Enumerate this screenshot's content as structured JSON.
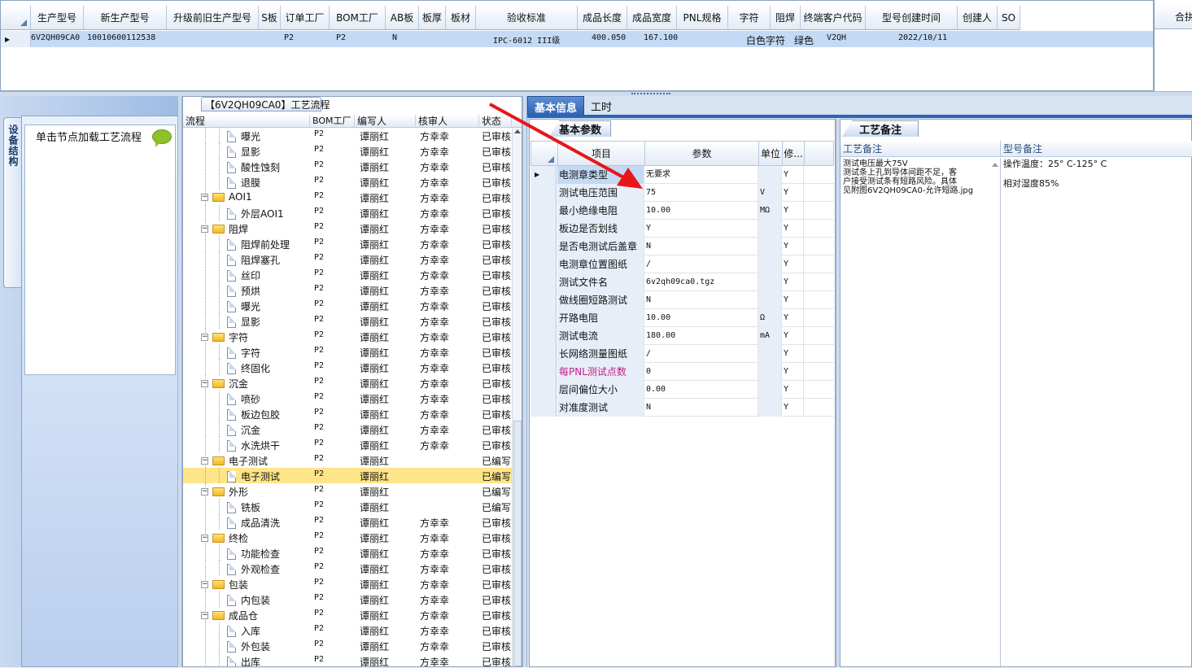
{
  "top_grid": {
    "columns": [
      "生产型号",
      "新生产型号",
      "升级前旧生产型号",
      "S板",
      "订单工厂",
      "BOM工厂",
      "AB板",
      "板厚",
      "板材",
      "验收标准",
      "成品长度",
      "成品宽度",
      "PNL规格",
      "字符",
      "阻焊",
      "终端客户代码",
      "型号创建时间",
      "创建人",
      "SO"
    ],
    "row": {
      "production_model": "6V2QH09CA0",
      "new_model": "10010600112538",
      "order_factory": "P2",
      "bom_factory": "P2",
      "ab_board": "N",
      "acceptance_standard": "IPC-6012 III级",
      "finished_length": "400.050",
      "finished_width": "167.100",
      "character": "白色字符",
      "solder_mask": "绿色",
      "customer_code": "V2QH",
      "created_time": "2022/10/11"
    },
    "right_header": "合拼"
  },
  "left_panel": {
    "vertical_tab": "设备结构",
    "load_hint": "单击节点加载工艺流程"
  },
  "flow": {
    "title": "【6V2QH09CA0】工艺流程",
    "columns": [
      "流程",
      "BOM工厂",
      "编写人",
      "核审人",
      "状态"
    ],
    "rows": [
      {
        "name": "曝光",
        "level": 2,
        "factory": "P2",
        "writer": "谭丽红",
        "reviewer": "方幸幸",
        "status": "已审核"
      },
      {
        "name": "显影",
        "level": 2,
        "factory": "P2",
        "writer": "谭丽红",
        "reviewer": "方幸幸",
        "status": "已审核"
      },
      {
        "name": "酸性蚀刻",
        "level": 2,
        "factory": "P2",
        "writer": "谭丽红",
        "reviewer": "方幸幸",
        "status": "已审核"
      },
      {
        "name": "退膜",
        "level": 2,
        "factory": "P2",
        "writer": "谭丽红",
        "reviewer": "方幸幸",
        "status": "已审核"
      },
      {
        "name": "AOI1",
        "level": 1,
        "factory": "P2",
        "writer": "谭丽红",
        "reviewer": "方幸幸",
        "status": "已审核"
      },
      {
        "name": "外层AOI1",
        "level": 2,
        "factory": "P2",
        "writer": "谭丽红",
        "reviewer": "方幸幸",
        "status": "已审核"
      },
      {
        "name": "阻焊",
        "level": 1,
        "factory": "P2",
        "writer": "谭丽红",
        "reviewer": "方幸幸",
        "status": "已审核"
      },
      {
        "name": "阻焊前处理",
        "level": 2,
        "factory": "P2",
        "writer": "谭丽红",
        "reviewer": "方幸幸",
        "status": "已审核"
      },
      {
        "name": "阻焊塞孔",
        "level": 2,
        "factory": "P2",
        "writer": "谭丽红",
        "reviewer": "方幸幸",
        "status": "已审核"
      },
      {
        "name": "丝印",
        "level": 2,
        "factory": "P2",
        "writer": "谭丽红",
        "reviewer": "方幸幸",
        "status": "已审核"
      },
      {
        "name": "预烘",
        "level": 2,
        "factory": "P2",
        "writer": "谭丽红",
        "reviewer": "方幸幸",
        "status": "已审核"
      },
      {
        "name": "曝光",
        "level": 2,
        "factory": "P2",
        "writer": "谭丽红",
        "reviewer": "方幸幸",
        "status": "已审核"
      },
      {
        "name": "显影",
        "level": 2,
        "factory": "P2",
        "writer": "谭丽红",
        "reviewer": "方幸幸",
        "status": "已审核"
      },
      {
        "name": "字符",
        "level": 1,
        "factory": "P2",
        "writer": "谭丽红",
        "reviewer": "方幸幸",
        "status": "已审核"
      },
      {
        "name": "字符",
        "level": 2,
        "factory": "P2",
        "writer": "谭丽红",
        "reviewer": "方幸幸",
        "status": "已审核"
      },
      {
        "name": "终固化",
        "level": 2,
        "factory": "P2",
        "writer": "谭丽红",
        "reviewer": "方幸幸",
        "status": "已审核"
      },
      {
        "name": "沉金",
        "level": 1,
        "factory": "P2",
        "writer": "谭丽红",
        "reviewer": "方幸幸",
        "status": "已审核"
      },
      {
        "name": "喷砂",
        "level": 2,
        "factory": "P2",
        "writer": "谭丽红",
        "reviewer": "方幸幸",
        "status": "已审核"
      },
      {
        "name": "板边包胶",
        "level": 2,
        "factory": "P2",
        "writer": "谭丽红",
        "reviewer": "方幸幸",
        "status": "已审核"
      },
      {
        "name": "沉金",
        "level": 2,
        "factory": "P2",
        "writer": "谭丽红",
        "reviewer": "方幸幸",
        "status": "已审核"
      },
      {
        "name": "水洗烘干",
        "level": 2,
        "factory": "P2",
        "writer": "谭丽红",
        "reviewer": "方幸幸",
        "status": "已审核"
      },
      {
        "name": "电子测试",
        "level": 1,
        "factory": "P2",
        "writer": "谭丽红",
        "reviewer": "",
        "status": "已编写"
      },
      {
        "name": "电子测试",
        "level": 2,
        "factory": "P2",
        "writer": "谭丽红",
        "reviewer": "",
        "status": "已编写",
        "selected": true
      },
      {
        "name": "外形",
        "level": 1,
        "factory": "P2",
        "writer": "谭丽红",
        "reviewer": "",
        "status": "已编写"
      },
      {
        "name": "铣板",
        "level": 2,
        "factory": "P2",
        "writer": "谭丽红",
        "reviewer": "",
        "status": "已编写"
      },
      {
        "name": "成品清洗",
        "level": 2,
        "factory": "P2",
        "writer": "谭丽红",
        "reviewer": "方幸幸",
        "status": "已审核"
      },
      {
        "name": "终检",
        "level": 1,
        "factory": "P2",
        "writer": "谭丽红",
        "reviewer": "方幸幸",
        "status": "已审核"
      },
      {
        "name": "功能检查",
        "level": 2,
        "factory": "P2",
        "writer": "谭丽红",
        "reviewer": "方幸幸",
        "status": "已审核"
      },
      {
        "name": "外观检查",
        "level": 2,
        "factory": "P2",
        "writer": "谭丽红",
        "reviewer": "方幸幸",
        "status": "已审核"
      },
      {
        "name": "包装",
        "level": 1,
        "factory": "P2",
        "writer": "谭丽红",
        "reviewer": "方幸幸",
        "status": "已审核"
      },
      {
        "name": "内包装",
        "level": 2,
        "factory": "P2",
        "writer": "谭丽红",
        "reviewer": "方幸幸",
        "status": "已审核"
      },
      {
        "name": "成品仓",
        "level": 1,
        "factory": "P2",
        "writer": "谭丽红",
        "reviewer": "方幸幸",
        "status": "已审核"
      },
      {
        "name": "入库",
        "level": 2,
        "factory": "P2",
        "writer": "谭丽红",
        "reviewer": "方幸幸",
        "status": "已审核"
      },
      {
        "name": "外包装",
        "level": 2,
        "factory": "P2",
        "writer": "谭丽红",
        "reviewer": "方幸幸",
        "status": "已审核"
      },
      {
        "name": "出库",
        "level": 2,
        "factory": "P2",
        "writer": "谭丽红",
        "reviewer": "方幸幸",
        "status": "已审核"
      }
    ]
  },
  "tabs": [
    {
      "label": "基本信息",
      "active": true
    },
    {
      "label": "工时",
      "active": false
    }
  ],
  "params": {
    "subtab": "基本参数",
    "columns": [
      "项目",
      "参数",
      "单位",
      "修..."
    ],
    "rows": [
      {
        "item": "电测章类型",
        "value": "无要求",
        "unit": "",
        "mod": "Y",
        "current": true
      },
      {
        "item": "测试电压范围",
        "value": "75",
        "unit": "V",
        "mod": "Y"
      },
      {
        "item": "最小绝缘电阻",
        "value": "10.00",
        "unit": "MΩ",
        "mod": "Y"
      },
      {
        "item": "板边是否划线",
        "value": "Y",
        "unit": "",
        "mod": "Y"
      },
      {
        "item": "是否电测试后盖章",
        "value": "N",
        "unit": "",
        "mod": "Y"
      },
      {
        "item": "电测章位置图纸",
        "value": "/",
        "unit": "",
        "mod": "Y"
      },
      {
        "item": "测试文件名",
        "value": "6v2qh09ca0.tgz",
        "unit": "",
        "mod": "Y"
      },
      {
        "item": "做线圈短路测试",
        "value": "N",
        "unit": "",
        "mod": "Y"
      },
      {
        "item": "开路电阻",
        "value": "10.00",
        "unit": "Ω",
        "mod": "Y"
      },
      {
        "item": "测试电流",
        "value": "180.00",
        "unit": "mA",
        "mod": "Y"
      },
      {
        "item": "长网络测量图纸",
        "value": "/",
        "unit": "",
        "mod": "Y"
      },
      {
        "item": "每PNL测试点数",
        "value": "0",
        "unit": "",
        "mod": "Y",
        "pink": true
      },
      {
        "item": "层间偏位大小",
        "value": "0.00",
        "unit": "",
        "mod": "Y"
      },
      {
        "item": "对准度测试",
        "value": "N",
        "unit": "",
        "mod": "Y"
      }
    ]
  },
  "notes": {
    "subtab": "工艺备注",
    "columns": [
      "工艺备注",
      "型号备注"
    ],
    "process_remark_lines": [
      "测试电压最大75V",
      "测试条上孔到导体间距不足，客",
      "户接受测试条有短路风险。具体",
      "见附图6V2QH09CA0-允许短路.jpg"
    ],
    "model_remark_lines": [
      "操作温度：25° C-125° C",
      "相对湿度85%"
    ]
  },
  "colors": {
    "accent": "#2e64b4",
    "selected_row": "#ffe58a",
    "grid_selection": "#c3d9f4",
    "annotation_arrow": "#e8151b"
  }
}
